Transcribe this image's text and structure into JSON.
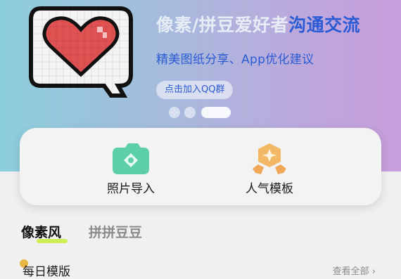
{
  "banner": {
    "title_part1": "像素/拼豆爱好者",
    "title_part2": "沟通交流",
    "subtitle": "精美图纸分享、App优化建议",
    "qq_button": "点击加入QQ群",
    "carousel_active_index": 2,
    "carousel_count": 3
  },
  "actions": [
    {
      "label": "照片导入",
      "icon": "photo-import-icon"
    },
    {
      "label": "人气模板",
      "icon": "popular-template-medal-icon"
    }
  ],
  "tabs": [
    {
      "label": "像素风",
      "active": true
    },
    {
      "label": "拼拼豆豆",
      "active": false
    }
  ],
  "section": {
    "title": "每日模版",
    "view_all": "查看全部",
    "view_all_chevron": "›"
  },
  "colors": {
    "accent_blue": "#2a5bd4",
    "tab_underline": "#cdee57",
    "photo_icon_green": "#5ccfa9",
    "medal_orange": "#f0a858"
  }
}
